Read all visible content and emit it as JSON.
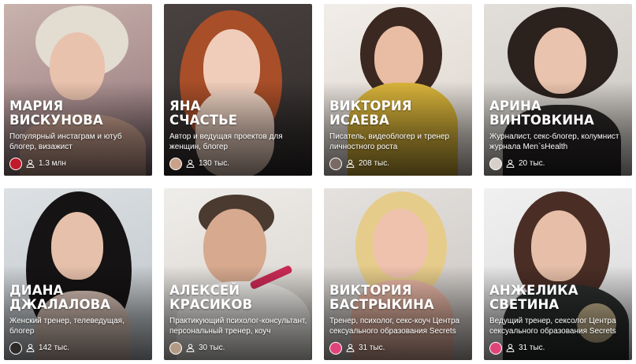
{
  "cards": [
    {
      "first_name": "Мария",
      "last_name": "Вискунова",
      "description": "Популярный инстаграм и ютуб блогер, визажист",
      "followers": "1.3 млн",
      "avatar_color": "#c2182b",
      "bg_color": "#b89a98"
    },
    {
      "first_name": "Яна",
      "last_name": "Счастье",
      "description": "Автор и ведущая проектов для женщин, блогер",
      "followers": "130 тыс.",
      "avatar_color": "#caa28a",
      "bg_color": "#3b3433"
    },
    {
      "first_name": "Виктория",
      "last_name": "Исаева",
      "description": "Писатель, видеоблогер и тренер личностного роста",
      "followers": "208 тыс.",
      "avatar_color": "#7a6a66",
      "bg_color": "#e9e3dd"
    },
    {
      "first_name": "Арина",
      "last_name": "Винтовкина",
      "description": "Журналист, секс-блогер, колумнист журнала Men`sHealth",
      "followers": "20 тыс.",
      "avatar_color": "#d8cfc8",
      "bg_color": "#d7d3ce"
    },
    {
      "first_name": "Диана",
      "last_name": "Джалалова",
      "description": "Женский тренер, телеведущая, блогер",
      "followers": "142 тыс.",
      "avatar_color": "#2d2a2a",
      "bg_color": "#cfd3d6"
    },
    {
      "first_name": "Алексей",
      "last_name": "Красиков",
      "description": "Практикующий психолог-консультант, персональный тренер, коуч",
      "followers": "30 тыс.",
      "avatar_color": "#b39a85",
      "bg_color": "#e7e4e0"
    },
    {
      "first_name": "Виктория",
      "last_name": "Бастрыкина",
      "description": "Тренер, психолог, секс-коуч Центра сексуального образования Secrets",
      "followers": "31 тыс.",
      "avatar_color": "#e0447a",
      "bg_color": "#d9d5d2"
    },
    {
      "first_name": "Анжелика",
      "last_name": "Светина",
      "description": "Ведущий тренер, сексолог Центра сексуального образования Secrets",
      "followers": "31 тыс.",
      "avatar_color": "#e0447a",
      "bg_color": "#e3e3e3"
    }
  ]
}
